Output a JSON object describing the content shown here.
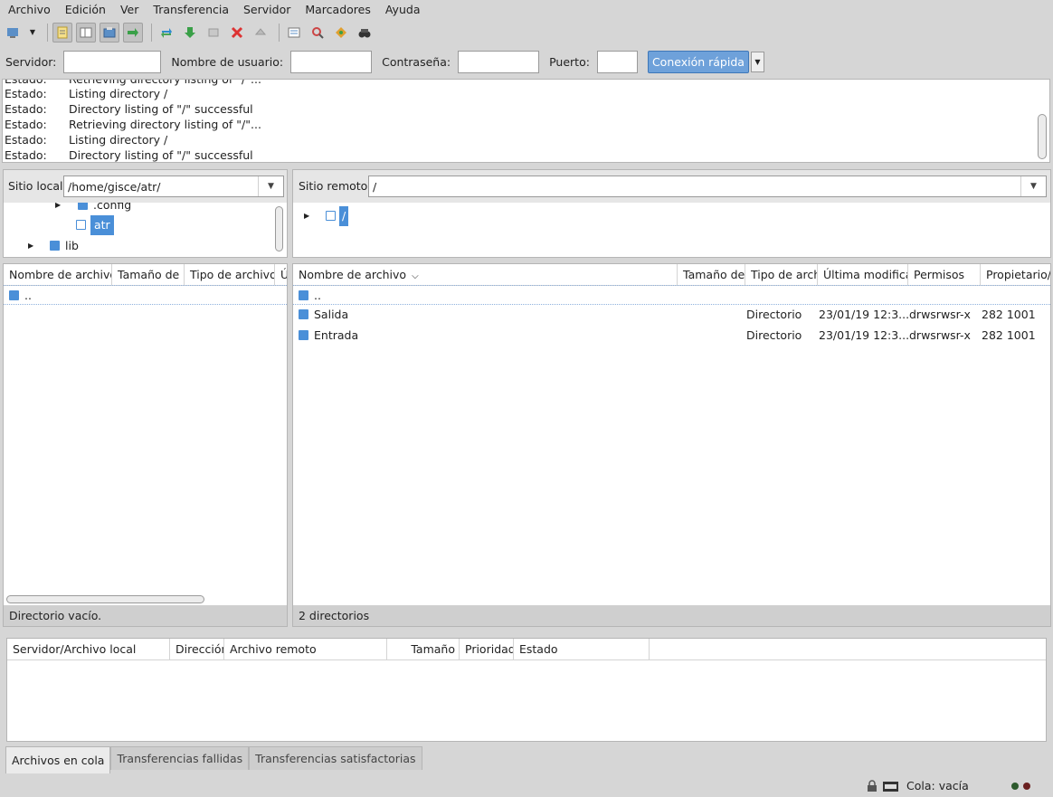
{
  "menu": [
    "Archivo",
    "Edición",
    "Ver",
    "Transferencia",
    "Servidor",
    "Marcadores",
    "Ayuda"
  ],
  "quickconnect": {
    "host_label": "Servidor:",
    "user_label": "Nombre de usuario:",
    "pass_label": "Contraseña:",
    "port_label": "Puerto:",
    "button": "Conexión rápida"
  },
  "log": [
    {
      "k": "Estado:",
      "v": "Retrieving directory listing of \"/\"..."
    },
    {
      "k": "Estado:",
      "v": "Listing directory /"
    },
    {
      "k": "Estado:",
      "v": "Directory listing of \"/\" successful"
    },
    {
      "k": "Estado:",
      "v": "Retrieving directory listing of \"/\"..."
    },
    {
      "k": "Estado:",
      "v": "Listing directory /"
    },
    {
      "k": "Estado:",
      "v": "Directory listing of \"/\" successful"
    }
  ],
  "local": {
    "label": "Sitio local:",
    "path": "/home/gisce/atr/",
    "tree": [
      ".config",
      "atr",
      "lib"
    ],
    "columns": [
      "Nombre de archivo",
      "Tamaño de a",
      "Tipo de archivo",
      "Ú"
    ],
    "files": [
      ".."
    ],
    "status": "Directorio vacío."
  },
  "remote": {
    "label": "Sitio remoto:",
    "path": "/",
    "tree": [
      "/"
    ],
    "columns": [
      "Nombre de archivo",
      "Tamaño de a",
      "Tipo de archi",
      "Última modificac",
      "Permisos",
      "Propietario/G"
    ],
    "files": [
      {
        "name": "..",
        "type": "",
        "modified": "",
        "perms": "",
        "owner": ""
      },
      {
        "name": "Salida",
        "type": "Directorio",
        "modified": "23/01/19 12:3...",
        "perms": "drwsrwsr-x",
        "owner": "282 1001"
      },
      {
        "name": "Entrada",
        "type": "Directorio",
        "modified": "23/01/19 12:3...",
        "perms": "drwsrwsr-x",
        "owner": "282 1001"
      }
    ],
    "status": "2 directorios"
  },
  "queue": {
    "columns": [
      "Servidor/Archivo local",
      "Dirección",
      "Archivo remoto",
      "Tamaño",
      "Prioridad",
      "Estado"
    ]
  },
  "tabs": [
    "Archivos en cola",
    "Transferencias fallidas",
    "Transferencias satisfactorias"
  ],
  "statusbar": {
    "queue": "Cola: vacía"
  },
  "colors": {
    "accent": "#6ea1da",
    "folder": "#4a8fd8"
  }
}
